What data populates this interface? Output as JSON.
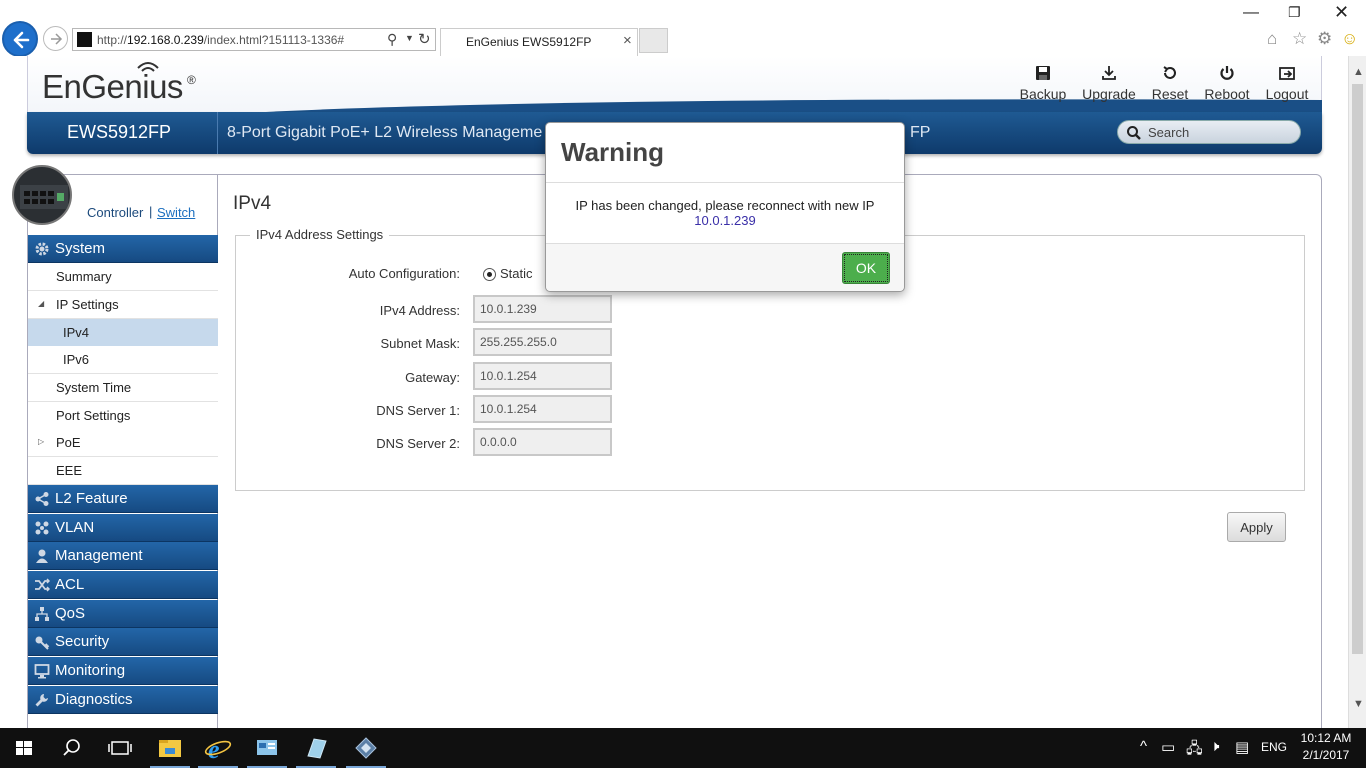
{
  "browser": {
    "url_prefix": "http://",
    "url_host": "192.168.0.239",
    "url_path": "/index.html?151113-1336#",
    "tab_title": "EnGenius EWS5912FP"
  },
  "header": {
    "brand": "EnGenius",
    "brand_mark": "®",
    "buttons": [
      {
        "label": "Backup",
        "icon": "floppy-icon"
      },
      {
        "label": "Upgrade",
        "icon": "download-icon"
      },
      {
        "label": "Reset",
        "icon": "reset-icon"
      },
      {
        "label": "Reboot",
        "icon": "power-icon"
      },
      {
        "label": "Logout",
        "icon": "logout-icon"
      }
    ]
  },
  "navbar": {
    "model": "EWS5912FP",
    "description": "8-Port Gigabit PoE+ L2 Wireless Manageme",
    "description_tail": "FP",
    "search_placeholder": "Search"
  },
  "sidebar": {
    "controller_label": "Controller",
    "separator": "|",
    "switch_label": "Switch",
    "categories": {
      "system": "System",
      "l2": "L2 Feature",
      "vlan": "VLAN",
      "management": "Management",
      "acl": "ACL",
      "qos": "QoS",
      "security": "Security",
      "monitoring": "Monitoring",
      "diagnostics": "Diagnostics"
    },
    "system_items": {
      "summary": "Summary",
      "ip_settings": "IP Settings",
      "ipv4": "IPv4",
      "ipv6": "IPv6",
      "system_time": "System Time",
      "port_settings": "Port Settings",
      "poe": "PoE",
      "eee": "EEE"
    }
  },
  "content": {
    "title": "IPv4",
    "fieldset_legend": "IPv4 Address Settings",
    "auto_config_label": "Auto Configuration:",
    "auto_config_value": "Static",
    "ipv4_label": "IPv4 Address:",
    "ipv4_value": "10.0.1.239",
    "subnet_label": "Subnet Mask:",
    "subnet_value": "255.255.255.0",
    "gateway_label": "Gateway:",
    "gateway_value": "10.0.1.254",
    "dns1_label": "DNS Server 1:",
    "dns1_value": "10.0.1.254",
    "dns2_label": "DNS Server 2:",
    "dns2_value": "0.0.0.0",
    "apply_label": "Apply"
  },
  "modal": {
    "title": "Warning",
    "message": "IP has been changed, please reconnect with new IP",
    "new_ip": "10.0.1.239",
    "ok_label": "OK"
  },
  "taskbar": {
    "time": "10:12 AM",
    "date": "2/1/2017",
    "language": "ENG"
  },
  "colors": {
    "navbar": "#164a82",
    "ok_button": "#4cae4c",
    "browser_back": "#1e6fcb",
    "active_menu": "#c6d9ec"
  }
}
